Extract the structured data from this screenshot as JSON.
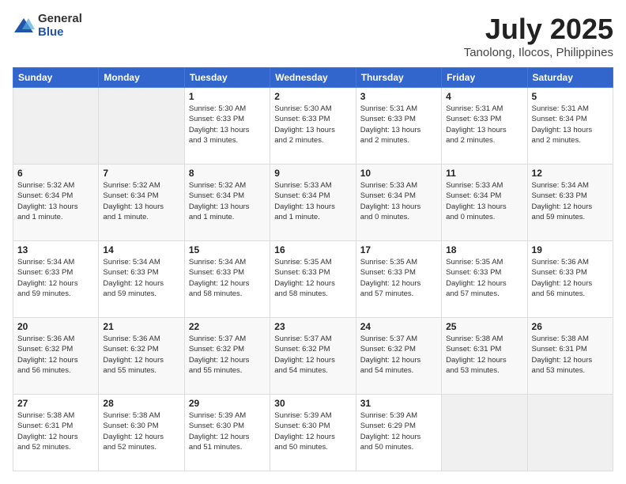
{
  "logo": {
    "general": "General",
    "blue": "Blue"
  },
  "header": {
    "title": "July 2025",
    "subtitle": "Tanolong, Ilocos, Philippines"
  },
  "weekdays": [
    "Sunday",
    "Monday",
    "Tuesday",
    "Wednesday",
    "Thursday",
    "Friday",
    "Saturday"
  ],
  "weeks": [
    [
      {
        "day": "",
        "info": ""
      },
      {
        "day": "",
        "info": ""
      },
      {
        "day": "1",
        "info": "Sunrise: 5:30 AM\nSunset: 6:33 PM\nDaylight: 13 hours\nand 3 minutes."
      },
      {
        "day": "2",
        "info": "Sunrise: 5:30 AM\nSunset: 6:33 PM\nDaylight: 13 hours\nand 2 minutes."
      },
      {
        "day": "3",
        "info": "Sunrise: 5:31 AM\nSunset: 6:33 PM\nDaylight: 13 hours\nand 2 minutes."
      },
      {
        "day": "4",
        "info": "Sunrise: 5:31 AM\nSunset: 6:33 PM\nDaylight: 13 hours\nand 2 minutes."
      },
      {
        "day": "5",
        "info": "Sunrise: 5:31 AM\nSunset: 6:34 PM\nDaylight: 13 hours\nand 2 minutes."
      }
    ],
    [
      {
        "day": "6",
        "info": "Sunrise: 5:32 AM\nSunset: 6:34 PM\nDaylight: 13 hours\nand 1 minute."
      },
      {
        "day": "7",
        "info": "Sunrise: 5:32 AM\nSunset: 6:34 PM\nDaylight: 13 hours\nand 1 minute."
      },
      {
        "day": "8",
        "info": "Sunrise: 5:32 AM\nSunset: 6:34 PM\nDaylight: 13 hours\nand 1 minute."
      },
      {
        "day": "9",
        "info": "Sunrise: 5:33 AM\nSunset: 6:34 PM\nDaylight: 13 hours\nand 1 minute."
      },
      {
        "day": "10",
        "info": "Sunrise: 5:33 AM\nSunset: 6:34 PM\nDaylight: 13 hours\nand 0 minutes."
      },
      {
        "day": "11",
        "info": "Sunrise: 5:33 AM\nSunset: 6:34 PM\nDaylight: 13 hours\nand 0 minutes."
      },
      {
        "day": "12",
        "info": "Sunrise: 5:34 AM\nSunset: 6:33 PM\nDaylight: 12 hours\nand 59 minutes."
      }
    ],
    [
      {
        "day": "13",
        "info": "Sunrise: 5:34 AM\nSunset: 6:33 PM\nDaylight: 12 hours\nand 59 minutes."
      },
      {
        "day": "14",
        "info": "Sunrise: 5:34 AM\nSunset: 6:33 PM\nDaylight: 12 hours\nand 59 minutes."
      },
      {
        "day": "15",
        "info": "Sunrise: 5:34 AM\nSunset: 6:33 PM\nDaylight: 12 hours\nand 58 minutes."
      },
      {
        "day": "16",
        "info": "Sunrise: 5:35 AM\nSunset: 6:33 PM\nDaylight: 12 hours\nand 58 minutes."
      },
      {
        "day": "17",
        "info": "Sunrise: 5:35 AM\nSunset: 6:33 PM\nDaylight: 12 hours\nand 57 minutes."
      },
      {
        "day": "18",
        "info": "Sunrise: 5:35 AM\nSunset: 6:33 PM\nDaylight: 12 hours\nand 57 minutes."
      },
      {
        "day": "19",
        "info": "Sunrise: 5:36 AM\nSunset: 6:33 PM\nDaylight: 12 hours\nand 56 minutes."
      }
    ],
    [
      {
        "day": "20",
        "info": "Sunrise: 5:36 AM\nSunset: 6:32 PM\nDaylight: 12 hours\nand 56 minutes."
      },
      {
        "day": "21",
        "info": "Sunrise: 5:36 AM\nSunset: 6:32 PM\nDaylight: 12 hours\nand 55 minutes."
      },
      {
        "day": "22",
        "info": "Sunrise: 5:37 AM\nSunset: 6:32 PM\nDaylight: 12 hours\nand 55 minutes."
      },
      {
        "day": "23",
        "info": "Sunrise: 5:37 AM\nSunset: 6:32 PM\nDaylight: 12 hours\nand 54 minutes."
      },
      {
        "day": "24",
        "info": "Sunrise: 5:37 AM\nSunset: 6:32 PM\nDaylight: 12 hours\nand 54 minutes."
      },
      {
        "day": "25",
        "info": "Sunrise: 5:38 AM\nSunset: 6:31 PM\nDaylight: 12 hours\nand 53 minutes."
      },
      {
        "day": "26",
        "info": "Sunrise: 5:38 AM\nSunset: 6:31 PM\nDaylight: 12 hours\nand 53 minutes."
      }
    ],
    [
      {
        "day": "27",
        "info": "Sunrise: 5:38 AM\nSunset: 6:31 PM\nDaylight: 12 hours\nand 52 minutes."
      },
      {
        "day": "28",
        "info": "Sunrise: 5:38 AM\nSunset: 6:30 PM\nDaylight: 12 hours\nand 52 minutes."
      },
      {
        "day": "29",
        "info": "Sunrise: 5:39 AM\nSunset: 6:30 PM\nDaylight: 12 hours\nand 51 minutes."
      },
      {
        "day": "30",
        "info": "Sunrise: 5:39 AM\nSunset: 6:30 PM\nDaylight: 12 hours\nand 50 minutes."
      },
      {
        "day": "31",
        "info": "Sunrise: 5:39 AM\nSunset: 6:29 PM\nDaylight: 12 hours\nand 50 minutes."
      },
      {
        "day": "",
        "info": ""
      },
      {
        "day": "",
        "info": ""
      }
    ]
  ]
}
